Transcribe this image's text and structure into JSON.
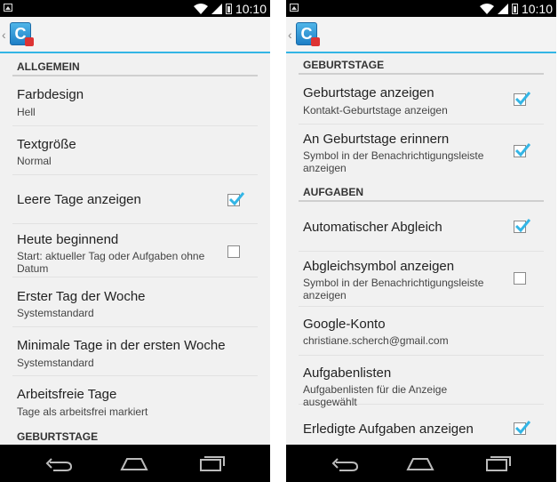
{
  "status": {
    "time": "10:10"
  },
  "left": {
    "sections": [
      {
        "kind": "category",
        "label": "ALLGEMEIN"
      },
      {
        "kind": "item",
        "title": "Farbdesign",
        "summary": "Hell"
      },
      {
        "kind": "item",
        "title": "Textgröße",
        "summary": "Normal"
      },
      {
        "kind": "item",
        "title": "Leere Tage anzeigen",
        "checked": true
      },
      {
        "kind": "item",
        "title": "Heute beginnend",
        "summary": "Start: aktueller Tag oder Aufgaben ohne Datum",
        "checked": false
      },
      {
        "kind": "item",
        "title": "Erster Tag der Woche",
        "summary": "Systemstandard"
      },
      {
        "kind": "item",
        "title": "Minimale Tage in der ersten Woche",
        "summary": "Systemstandard"
      },
      {
        "kind": "item",
        "title": "Arbeitsfreie Tage",
        "summary": "Tage als arbeitsfrei markiert"
      },
      {
        "kind": "category",
        "label": "GEBURTSTAGE"
      }
    ]
  },
  "right": {
    "sections": [
      {
        "kind": "category",
        "label": "GEBURTSTAGE"
      },
      {
        "kind": "item",
        "title": "Geburtstage anzeigen",
        "summary": "Kontakt-Geburtstage anzeigen",
        "checked": true
      },
      {
        "kind": "item",
        "title": "An Geburtstage erinnern",
        "summary": "Symbol in der Benachrichtigungsleiste anzeigen",
        "checked": true
      },
      {
        "kind": "category",
        "label": "AUFGABEN"
      },
      {
        "kind": "item",
        "title": "Automatischer Abgleich",
        "checked": true
      },
      {
        "kind": "item",
        "title": "Abgleichsymbol anzeigen",
        "summary": "Symbol in der Benachrichtigungsleiste anzeigen",
        "checked": false
      },
      {
        "kind": "item",
        "title": "Google-Konto",
        "summary": "christiane.scherch@gmail.com"
      },
      {
        "kind": "item",
        "title": "Aufgabenlisten",
        "summary": "Aufgabenlisten für die Anzeige ausgewählt"
      },
      {
        "kind": "item",
        "title": "Erledigte Aufgaben anzeigen",
        "checked": true
      }
    ]
  },
  "colors": {
    "accent": "#33b5e5",
    "checkmark": "#33b5e5"
  },
  "icons": [
    "back-nav-icon",
    "home-nav-icon",
    "recents-nav-icon",
    "wifi-icon",
    "signal-icon",
    "battery-icon",
    "app-icon"
  ]
}
